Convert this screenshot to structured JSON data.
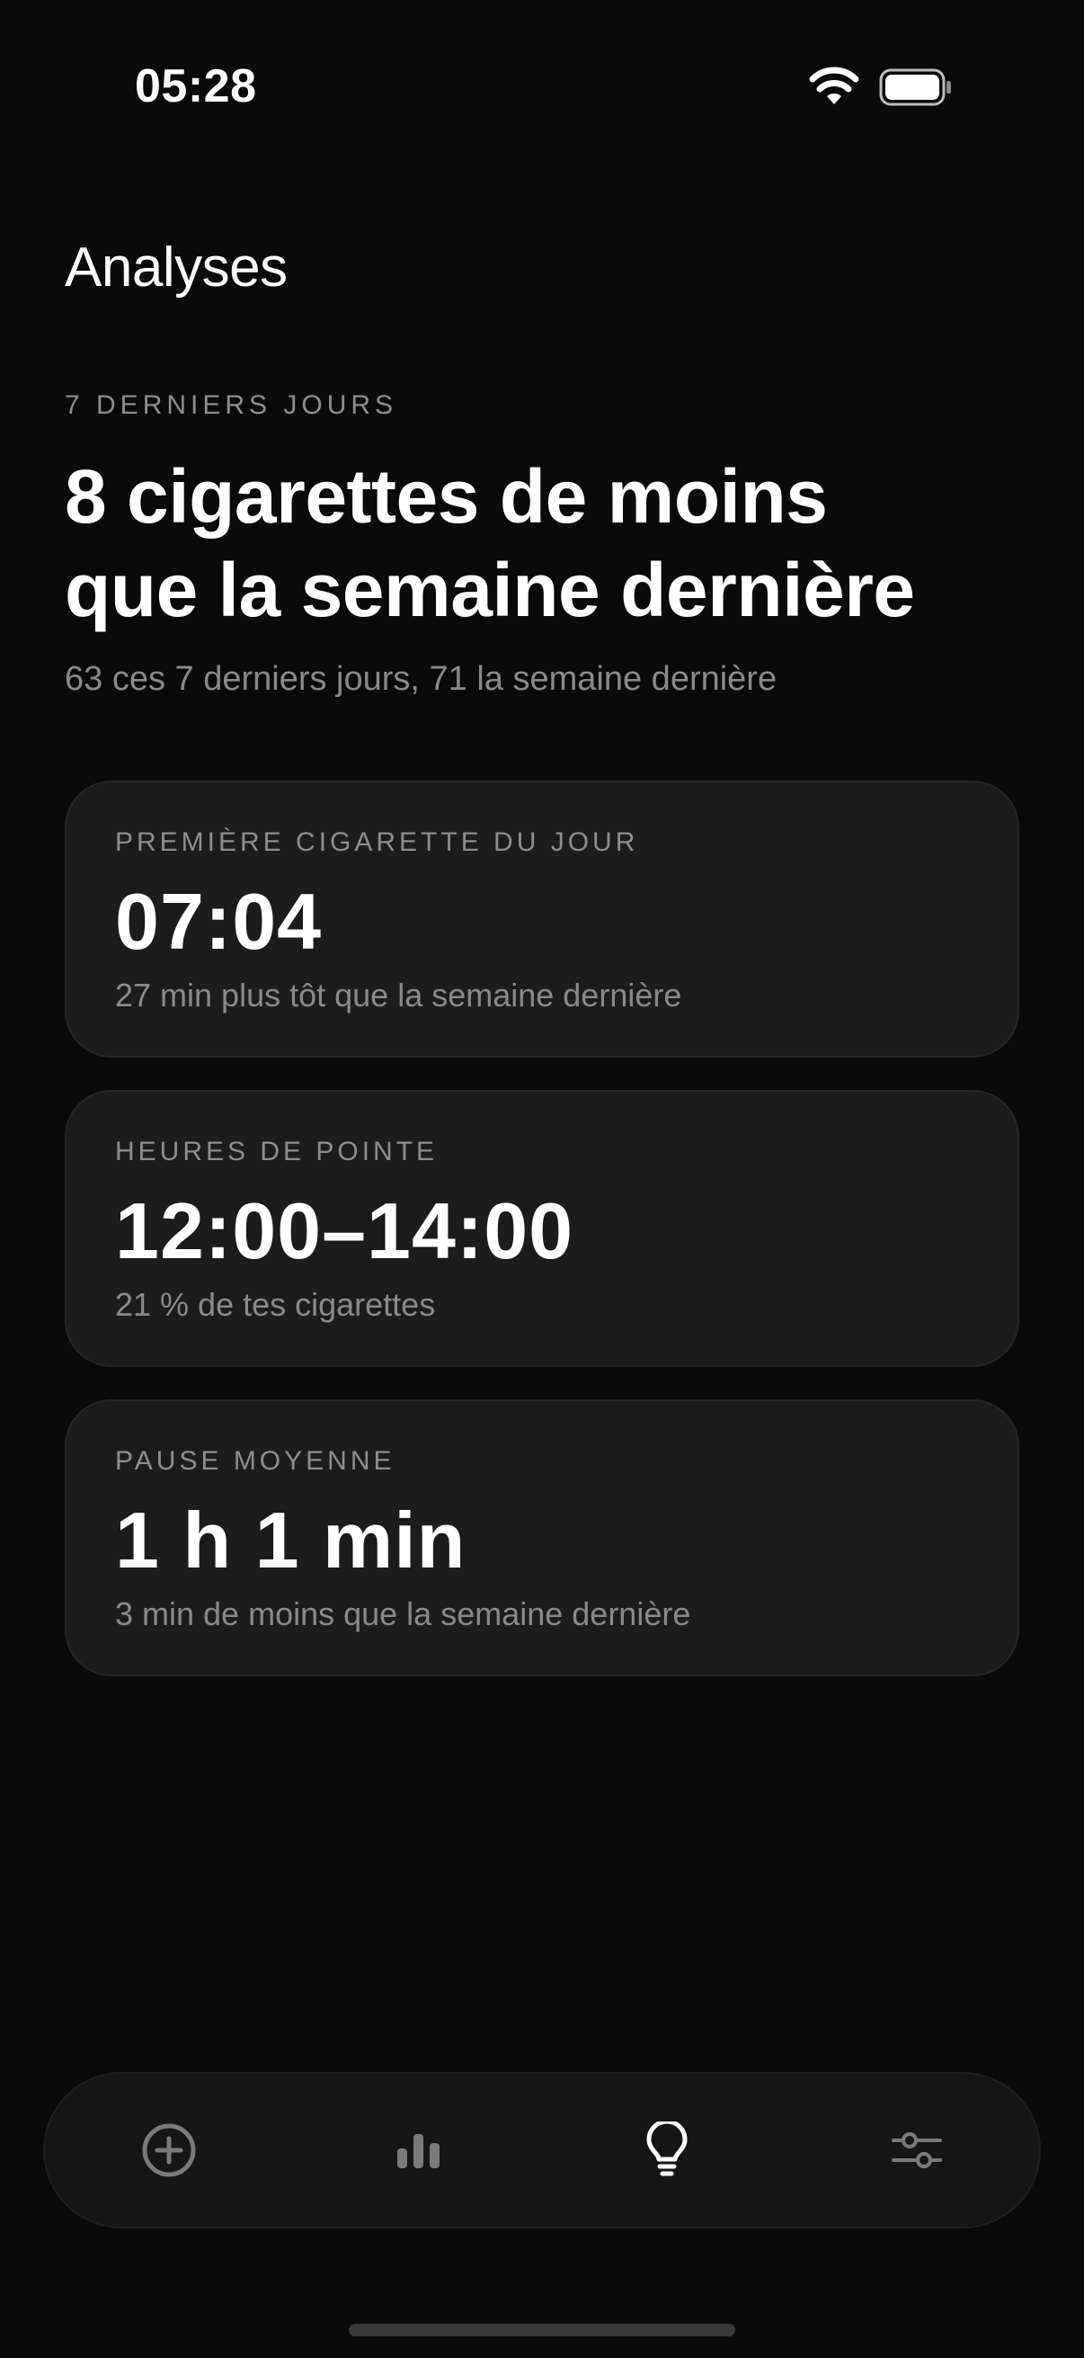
{
  "status_bar": {
    "time": "05:28",
    "icons": [
      "wifi-icon",
      "battery-icon"
    ]
  },
  "page": {
    "title": "Analyses"
  },
  "summary": {
    "label": "7 DERNIERS JOURS",
    "headline_line1": "8 cigarettes de moins",
    "headline_line2": "que la semaine dernière",
    "subline": "63 ces 7 derniers jours, 71 la semaine dernière"
  },
  "cards": [
    {
      "label": "PREMIÈRE CIGARETTE DU JOUR",
      "value": "07:04",
      "description": "27 min plus tôt que la semaine dernière"
    },
    {
      "label": "HEURES DE POINTE",
      "value": "12:00–14:00",
      "description": "21 % de tes cigarettes"
    },
    {
      "label": "PAUSE MOYENNE",
      "value": "1 h 1 min",
      "description": "3 min de moins que la semaine dernière"
    }
  ],
  "tab_bar": {
    "tabs": [
      {
        "icon": "plus-circle-icon",
        "active": false
      },
      {
        "icon": "bar-chart-icon",
        "active": false
      },
      {
        "icon": "lightbulb-icon",
        "active": true
      },
      {
        "icon": "sliders-icon",
        "active": false
      }
    ]
  },
  "colors": {
    "background": "#0a0a0a",
    "card": "#1c1c1c",
    "text_primary": "#ffffff",
    "text_secondary": "#8a8a8a",
    "tab_inactive": "#7a7a7a"
  }
}
